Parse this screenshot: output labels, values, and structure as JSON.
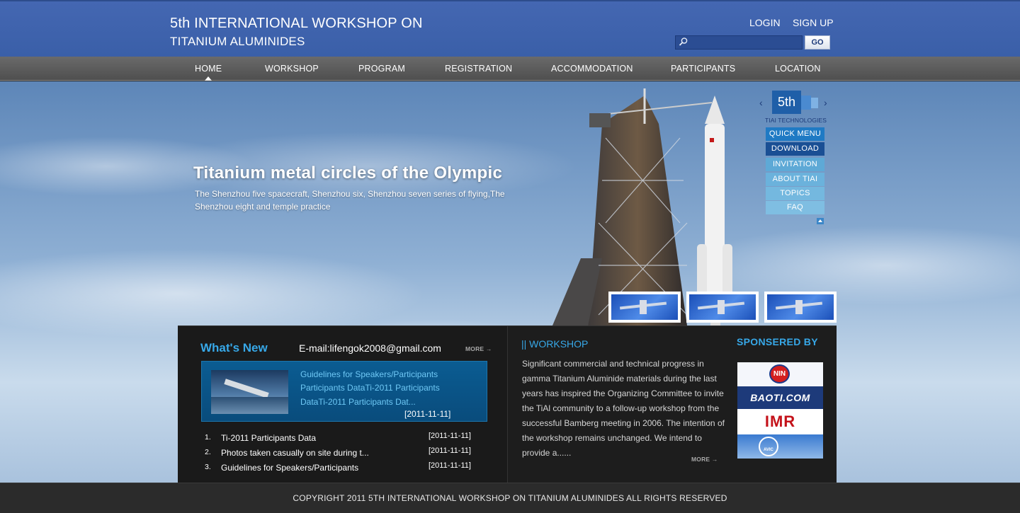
{
  "header": {
    "title_line1": "5th INTERNATIONAL WORKSHOP ON",
    "title_line2": "TITANIUM ALUMINIDES",
    "login": "LOGIN",
    "signup": "SIGN UP",
    "search_value": "",
    "go_label": "GO"
  },
  "nav": {
    "items": [
      {
        "label": "HOME"
      },
      {
        "label": "WORKSHOP"
      },
      {
        "label": "PROGRAM"
      },
      {
        "label": "REGISTRATION"
      },
      {
        "label": "ACCOMMODATION"
      },
      {
        "label": "PARTICIPANTS"
      },
      {
        "label": "LOCATION"
      }
    ]
  },
  "hero": {
    "title": "Titanium metal circles of the Olympic",
    "description": "The Shenzhou five spacecraft, Shenzhou six, Shenzhou seven series of flying,The Shenzhou eight and temple practice"
  },
  "quick_menu": {
    "badge": "5th",
    "subtitle": "TIAI TECHNOLOGIES",
    "prev": "‹",
    "next": "›",
    "items": [
      {
        "label": "QUICK MENU",
        "color": "#1f7ac4"
      },
      {
        "label": "DOWNLOAD",
        "color": "#1a4f94"
      },
      {
        "label": "INVITATION",
        "color": "#5ea9d6"
      },
      {
        "label": "ABOUT TIAI",
        "color": "#6bb2dc"
      },
      {
        "label": "TOPICS",
        "color": "#74b8df"
      },
      {
        "label": "FAQ",
        "color": "#7fbee2"
      }
    ]
  },
  "whats_new": {
    "title": "What's New",
    "email": "E-mail:lifengok2008@gmail.com",
    "more": "MORE →",
    "featured": {
      "lines": [
        "Guidelines for Speakers/Participants",
        "Participants DataTi-2011 Participants",
        "DataTi-2011 Participants Dat..."
      ],
      "date": "[2011-11-11]"
    },
    "items": [
      {
        "num": "1.",
        "title": "Ti-2011 Participants Data",
        "date": "[2011-11-11]"
      },
      {
        "num": "2.",
        "title": "Photos taken casually on site during t...",
        "date": "[2011-11-11]"
      },
      {
        "num": "3.",
        "title": "Guidelines for Speakers/Participants",
        "date": "[2011-11-11]"
      }
    ]
  },
  "workshop": {
    "title": "|| WORKSHOP",
    "text": "Significant commercial and technical progress in gamma Titanium Aluminide materials during the last years has inspired the Organizing Committee to invite the TiAl community to a follow-up workshop from the successful Bamberg meeting in 2006. The intention of the workshop remains unchanged. We intend to provide a......",
    "more": "MORE →"
  },
  "sponsors": {
    "title": "SPONSERED BY",
    "logos": [
      "NIN",
      "BAOTI.COM",
      "IMR",
      "AVIC"
    ]
  },
  "footer": {
    "copyright": "COPYRIGHT  2011  5TH INTERNATIONAL WORKSHOP ON TITANIUM ALUMINIDES  ALL RIGHTS RESERVED"
  }
}
